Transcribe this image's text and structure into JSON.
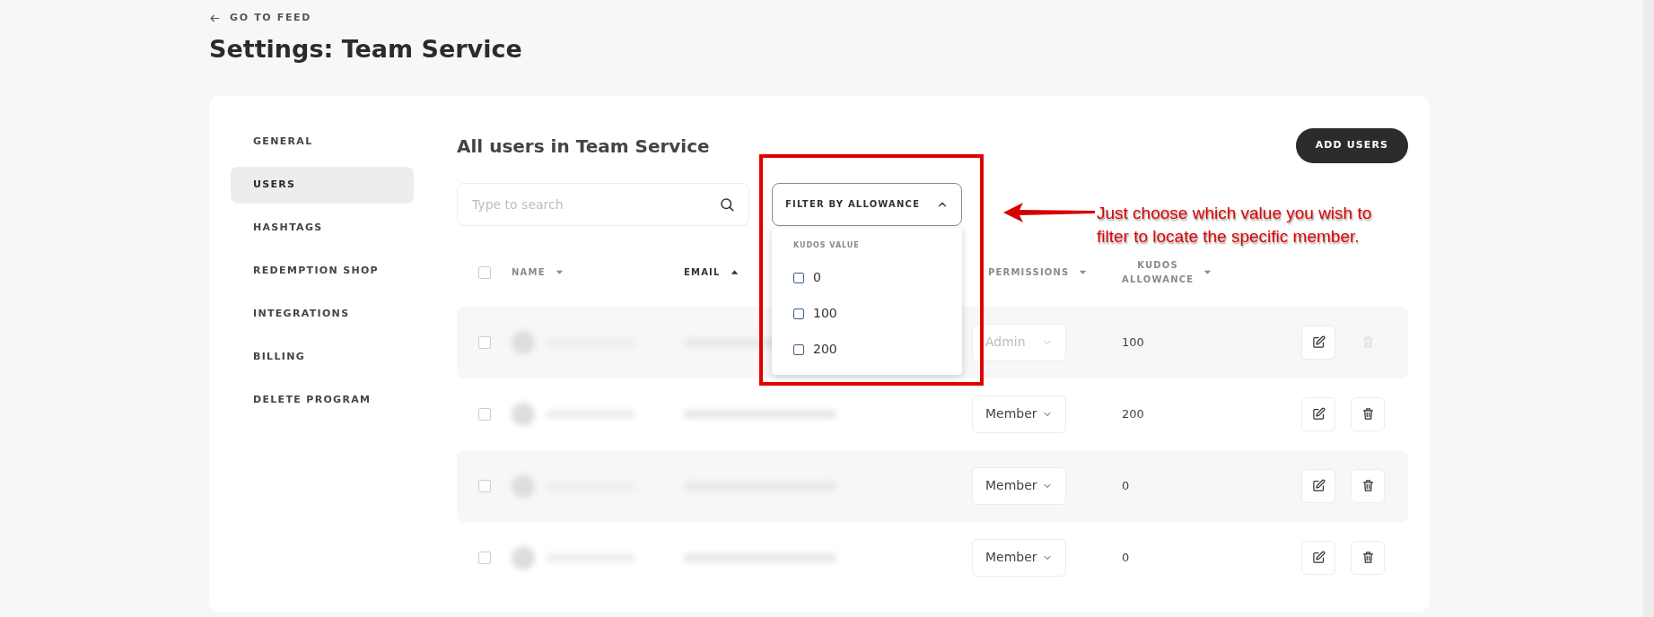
{
  "back_link": {
    "label": "GO TO FEED"
  },
  "page_title": "Settings: Team Service",
  "sidebar": {
    "items": [
      {
        "label": "GENERAL",
        "selected": false
      },
      {
        "label": "USERS",
        "selected": true
      },
      {
        "label": "HASHTAGS",
        "selected": false
      },
      {
        "label": "REDEMPTION SHOP",
        "selected": false
      },
      {
        "label": "INTEGRATIONS",
        "selected": false
      },
      {
        "label": "BILLING",
        "selected": false
      },
      {
        "label": "DELETE PROGRAM",
        "selected": false
      }
    ]
  },
  "main": {
    "heading": "All users in Team Service",
    "add_button": "ADD USERS",
    "search": {
      "placeholder": "Type to search"
    },
    "filter": {
      "label": "FILTER BY ALLOWANCE",
      "expanded": true,
      "menu": {
        "heading": "KUDOS VALUE",
        "options": [
          {
            "label": "0",
            "checked": false
          },
          {
            "label": "100",
            "checked": false
          },
          {
            "label": "200",
            "checked": false
          }
        ]
      }
    },
    "table": {
      "select_all": {
        "checked": false
      },
      "columns": [
        {
          "label": "NAME",
          "sorted_ascending": false
        },
        {
          "label": "EMAIL",
          "sorted_ascending": true
        },
        {
          "label": "PERMISSIONS",
          "sorted_ascending": false
        },
        {
          "label": "KUDOS ALLOWANCE",
          "sorted_ascending": false
        }
      ],
      "rows": [
        {
          "checked": false,
          "permission": "Admin",
          "permission_disabled": true,
          "allowance": "100",
          "delete_disabled": true
        },
        {
          "checked": false,
          "permission": "Member",
          "permission_disabled": false,
          "allowance": "200",
          "delete_disabled": false
        },
        {
          "checked": false,
          "permission": "Member",
          "permission_disabled": false,
          "allowance": "0",
          "delete_disabled": false
        },
        {
          "checked": false,
          "permission": "Member",
          "permission_disabled": false,
          "allowance": "0",
          "delete_disabled": false
        }
      ]
    }
  },
  "annotation": {
    "text": "Just choose which value you wish to filter to locate the specific member."
  }
}
